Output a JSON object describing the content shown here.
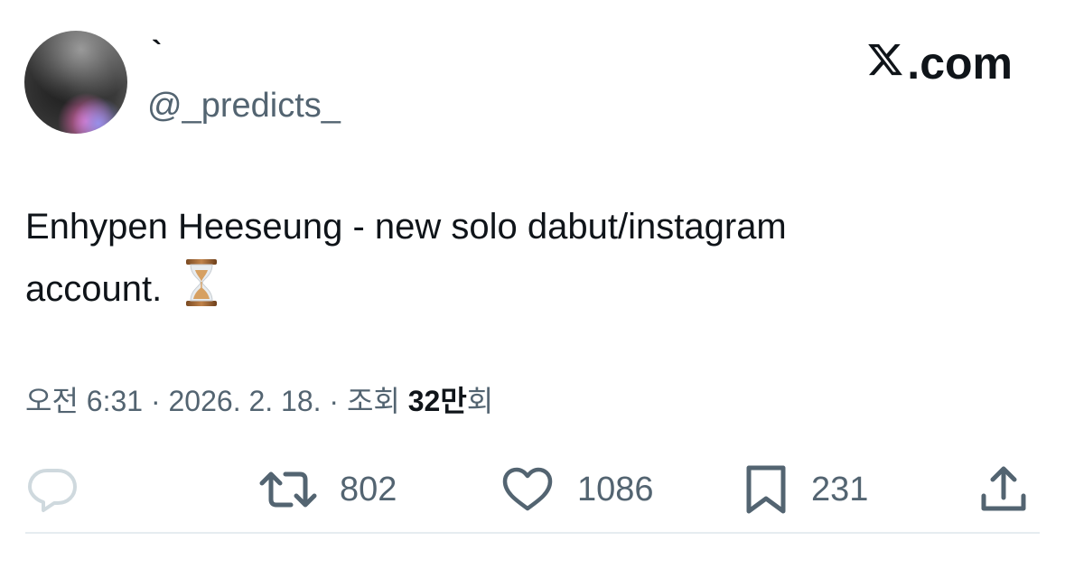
{
  "author": {
    "display_name": "`",
    "handle": "@_predicts_"
  },
  "brand": {
    "label": ".com"
  },
  "tweet": {
    "line1": "Enhypen Heeseung - new solo dabut/instagram",
    "line2": "account.",
    "emoji": "hourglass-done"
  },
  "meta": {
    "time": "오전 6:31",
    "date": "2026. 2. 18.",
    "views_label": "조회",
    "views_count": "32만",
    "views_suffix": "회"
  },
  "actions": {
    "retweets": "802",
    "likes": "1086",
    "bookmarks": "231"
  },
  "colors": {
    "text": "#0f1419",
    "secondary": "#536471",
    "reply_icon": "#cfd9de",
    "divider": "#e6ecf0"
  },
  "icons": [
    "reply-icon",
    "retweet-icon",
    "heart-icon",
    "bookmark-icon",
    "share-icon",
    "x-logo-icon",
    "hourglass-icon"
  ]
}
